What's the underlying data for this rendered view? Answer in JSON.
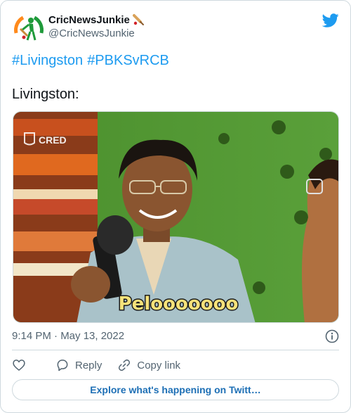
{
  "author": {
    "name": "CricNewsJunkie",
    "handle": "@CricNewsJunkie",
    "name_emoji": "cricket-bat-emoji"
  },
  "tweet": {
    "hashtags": [
      "#Livingston",
      "#PBKSvRCB"
    ],
    "body_line": "Livingston:",
    "media": {
      "watermark": "CRED",
      "caption": "Pelooooooo"
    },
    "timestamp": "9:14 PM · May 13, 2022"
  },
  "actions": {
    "like_icon": "heart-icon",
    "reply_label": "Reply",
    "copy_link_label": "Copy link"
  },
  "explore_label": "Explore what's happening on Twitt…",
  "colors": {
    "accent": "#1d9bf0",
    "secondary_text": "#536471",
    "border": "#cfd9de"
  }
}
